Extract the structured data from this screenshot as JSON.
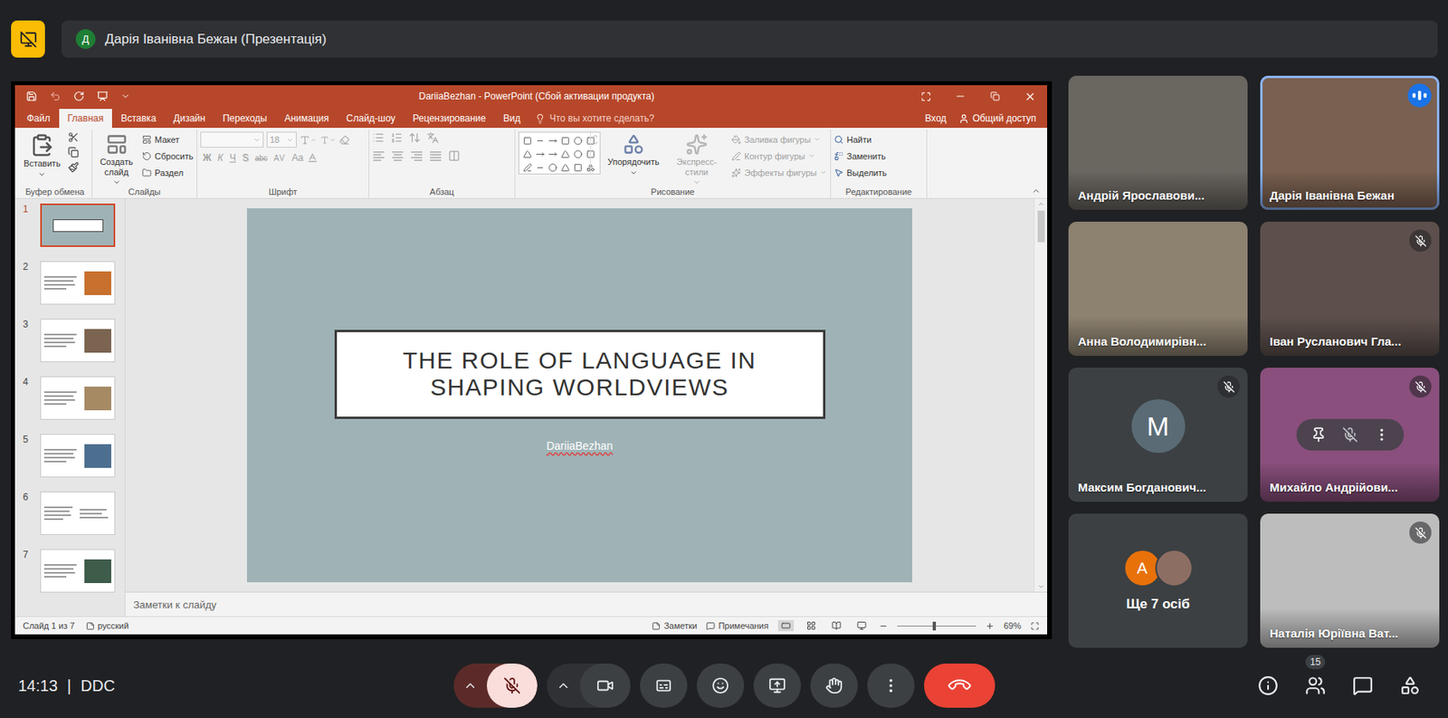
{
  "presenter_bar": {
    "avatar": "Д",
    "title": "Дарія Іванівна Бежан (Презентація)"
  },
  "powerpoint": {
    "title": "DariiaBezhan - PowerPoint (Сбой активации продукта)",
    "tabs": [
      {
        "label": "Файл",
        "selected": false
      },
      {
        "label": "Главная",
        "selected": true
      },
      {
        "label": "Вставка",
        "selected": false
      },
      {
        "label": "Дизайн",
        "selected": false
      },
      {
        "label": "Переходы",
        "selected": false
      },
      {
        "label": "Анимация",
        "selected": false
      },
      {
        "label": "Слайд-шоу",
        "selected": false
      },
      {
        "label": "Рецензирование",
        "selected": false
      },
      {
        "label": "Вид",
        "selected": false
      }
    ],
    "tell_me": "Что вы хотите сделать?",
    "sign_in": "Вход",
    "share": "Общий доступ",
    "ribbon": {
      "clipboard": {
        "label": "Буфер обмена",
        "paste": "Вставить"
      },
      "slides": {
        "label": "Слайды",
        "new_slide": "Создать слайд",
        "items": [
          "Макет",
          "Сбросить",
          "Раздел"
        ]
      },
      "font": {
        "label": "Шрифт",
        "size": "18",
        "disabled": true,
        "formats": [
          {
            "label": "Ж",
            "kind": "bold"
          },
          {
            "label": "К",
            "kind": "italic"
          },
          {
            "label": "Ч",
            "kind": "underline"
          },
          {
            "label": "S",
            "kind": "shadow"
          },
          {
            "label": "abc",
            "kind": "strike"
          },
          {
            "label": "AV",
            "kind": "spacing"
          },
          {
            "label": "Aa",
            "kind": "case"
          }
        ]
      },
      "paragraph": {
        "label": "Абзац",
        "disabled": true
      },
      "drawing": {
        "label": "Рисование",
        "arrange": {
          "label": "Упорядочить",
          "disabled": false
        },
        "quick_styles": {
          "label": "Экспресс-стили",
          "disabled": true
        },
        "items": [
          {
            "label": "Заливка фигуры",
            "disabled": true
          },
          {
            "label": "Контур фигуры",
            "disabled": true
          },
          {
            "label": "Эффекты фигуры",
            "disabled": true
          }
        ]
      },
      "editing": {
        "label": "Редактирование",
        "items": [
          {
            "label": "Найти",
            "disabled": false
          },
          {
            "label": "Заменить",
            "disabled": false
          },
          {
            "label": "Выделить",
            "disabled": false
          }
        ]
      }
    },
    "thumbnails": [
      {
        "number": "1",
        "selected": true,
        "kind": "title"
      },
      {
        "number": "2",
        "selected": false,
        "kind": "content",
        "color": "#c8702e"
      },
      {
        "number": "3",
        "selected": false,
        "kind": "content",
        "color": "#7b6450"
      },
      {
        "number": "4",
        "selected": false,
        "kind": "content",
        "color": "#a68a64"
      },
      {
        "number": "5",
        "selected": false,
        "kind": "content",
        "color": "#4d6f8f"
      },
      {
        "number": "6",
        "selected": false,
        "kind": "text"
      },
      {
        "number": "7",
        "selected": false,
        "kind": "content",
        "color": "#3e5c4a"
      }
    ],
    "slide": {
      "title": "THE ROLE OF LANGUAGE IN SHAPING WORLDVIEWS",
      "subtitle": "DariiaBezhan"
    },
    "notes_placeholder": "Заметки к слайду",
    "status_bar": {
      "slide_counter": "Слайд 1 из 7",
      "language": "русский",
      "notes": "Заметки",
      "comments": "Примечания",
      "zoom": "69%",
      "zoom_level": 0.45
    }
  },
  "participants": [
    {
      "name": "Андрій Ярославови...",
      "kind": "video",
      "color": "#6a6660",
      "muted": false,
      "speaking": false,
      "hovered": false
    },
    {
      "name": "Дарія Іванівна Бежан",
      "kind": "video",
      "color": "#7a6050",
      "muted": false,
      "speaking": true,
      "hovered": false
    },
    {
      "name": "Анна Володимирівн...",
      "kind": "video",
      "color": "#8d8270",
      "muted": false,
      "speaking": false,
      "hovered": false
    },
    {
      "name": "Іван Русланович Гла...",
      "kind": "video",
      "color": "#5d504c",
      "muted": true,
      "speaking": false,
      "hovered": false
    },
    {
      "name": "Максим Богданович...",
      "kind": "avatar",
      "letter": "M",
      "color": "#5a6b75",
      "muted": true,
      "speaking": false,
      "hovered": false
    },
    {
      "name": "Михайло Андрійови...",
      "kind": "video",
      "color": "#8a4f7d",
      "muted": true,
      "speaking": false,
      "hovered": true
    },
    {
      "label": "Ще 7 осіб",
      "kind": "overflow",
      "muted": false,
      "speaking": false,
      "hovered": false,
      "avatars": [
        {
          "kind": "letter",
          "letter": "A",
          "color": "#e8710a"
        },
        {
          "kind": "photo",
          "color": "#8d6e63"
        }
      ]
    },
    {
      "name": "Наталія Юріївна Ват...",
      "kind": "video",
      "color": "#bdbdbd",
      "muted": true,
      "speaking": false,
      "hovered": false
    }
  ],
  "bottom_bar": {
    "time": "14:13",
    "separator": "|",
    "meeting_code": "DDC",
    "mic_muted": true,
    "camera_on": true,
    "hand_raised": false,
    "people_count": "15"
  }
}
